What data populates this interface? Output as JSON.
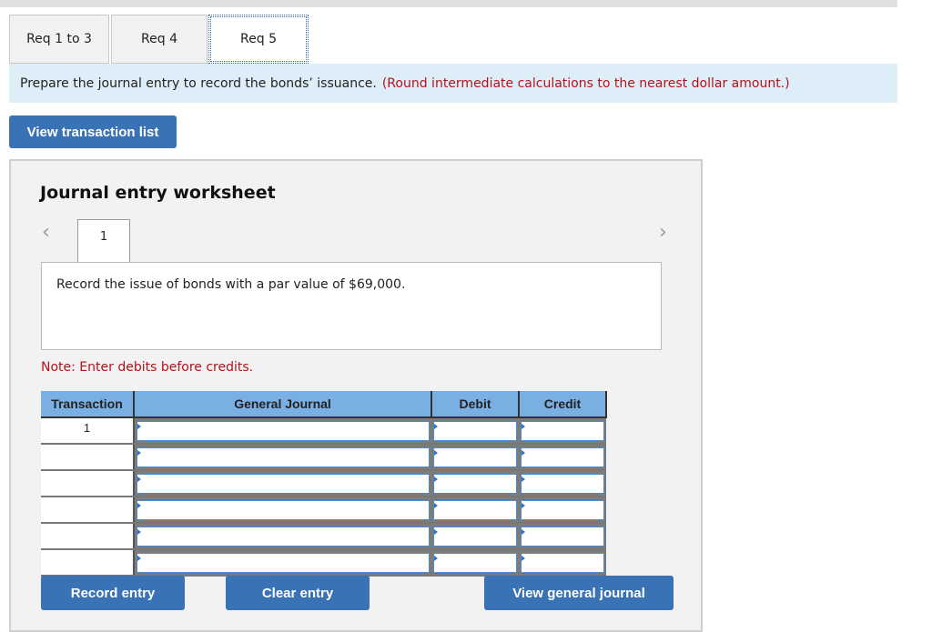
{
  "tabs": [
    {
      "label": "Req 1 to 3",
      "active": false
    },
    {
      "label": "Req 4",
      "active": false
    },
    {
      "label": "Req 5",
      "active": true
    }
  ],
  "instruction": {
    "text": "Prepare the journal entry to record the bonds’ issuance.",
    "note": "(Round intermediate calculations to the nearest dollar amount.)"
  },
  "view_transaction_list_label": "View transaction list",
  "worksheet": {
    "title": "Journal entry worksheet",
    "prev_icon": "chevron-left-icon",
    "next_icon": "chevron-right-icon",
    "current_page": "1",
    "description": "Record the issue of bonds with a par value of $69,000.",
    "note": "Note: Enter debits before credits.",
    "table": {
      "headers": [
        "Transaction",
        "General Journal",
        "Debit",
        "Credit"
      ],
      "rows": [
        {
          "transaction": "1",
          "account": "",
          "debit": "",
          "credit": ""
        },
        {
          "transaction": "",
          "account": "",
          "debit": "",
          "credit": ""
        },
        {
          "transaction": "",
          "account": "",
          "debit": "",
          "credit": ""
        },
        {
          "transaction": "",
          "account": "",
          "debit": "",
          "credit": ""
        },
        {
          "transaction": "",
          "account": "",
          "debit": "",
          "credit": ""
        },
        {
          "transaction": "",
          "account": "",
          "debit": "",
          "credit": ""
        }
      ]
    },
    "buttons": {
      "record": "Record entry",
      "clear": "Clear entry",
      "view_journal": "View general journal"
    }
  }
}
